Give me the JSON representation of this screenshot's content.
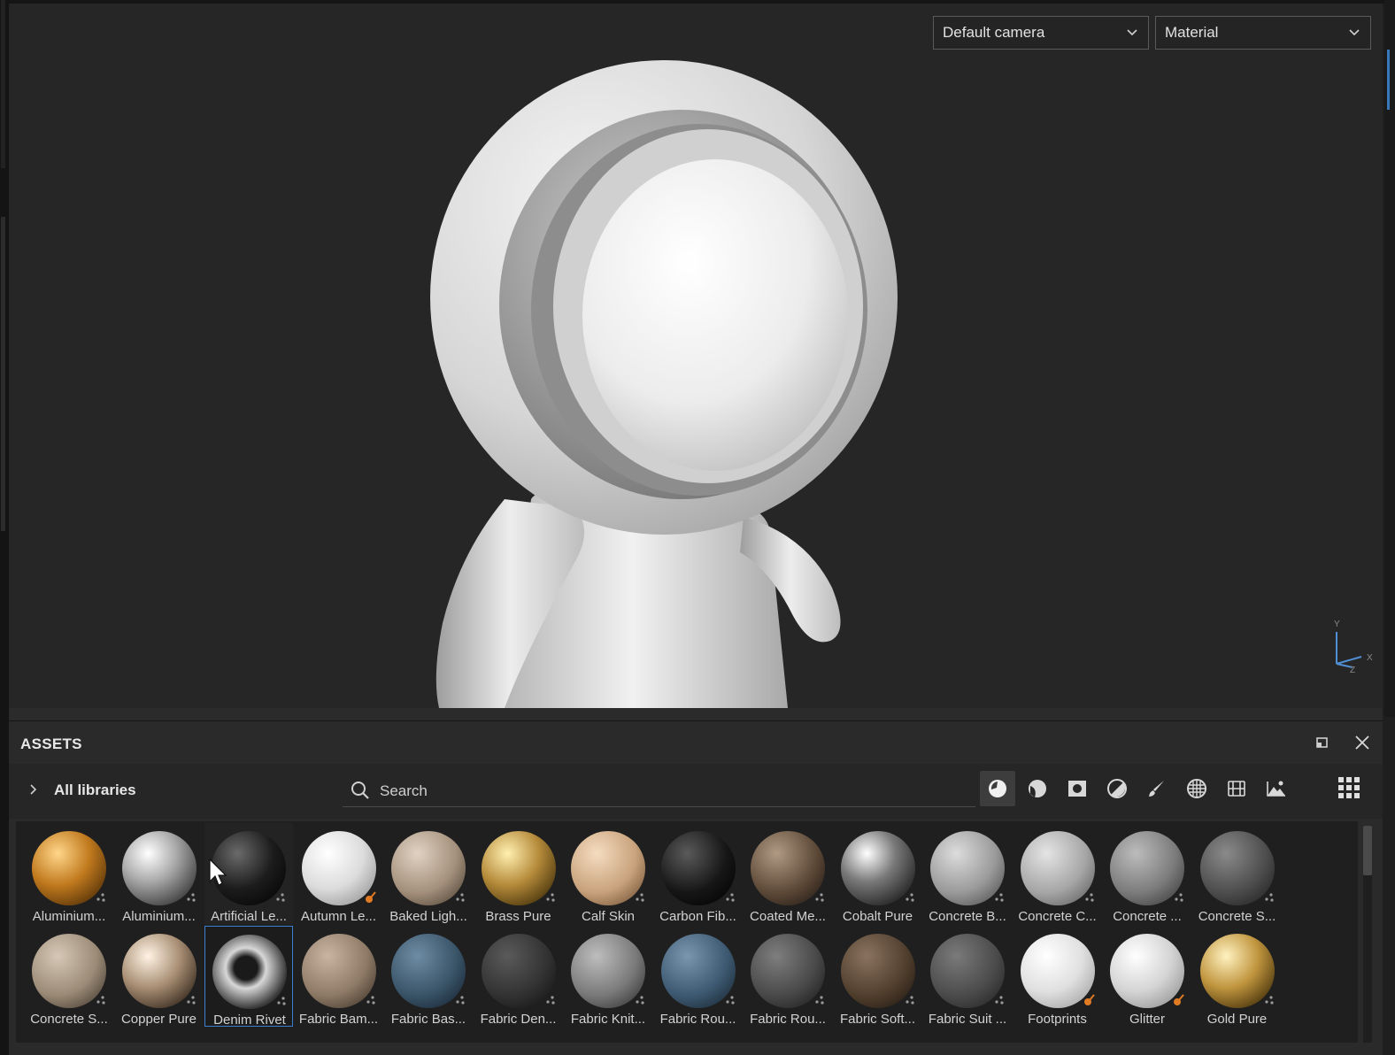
{
  "viewport": {
    "camera_select": "Default camera",
    "mode_select": "Material",
    "axis": {
      "y": "Y",
      "x": "X",
      "z": "Z"
    }
  },
  "assets_panel": {
    "title": "ASSETS",
    "libraries_label": "All libraries",
    "search_placeholder": "Search",
    "filters": [
      "materials-icon",
      "smart-materials-icon",
      "smart-masks-icon",
      "filters-icon",
      "brushes-icon",
      "textures-icon",
      "generators-icon",
      "environments-icon"
    ],
    "active_filter": "materials-icon"
  },
  "materials_row1": [
    {
      "label": "Aluminium...",
      "icon": "material-ball"
    },
    {
      "label": "Aluminium...",
      "icon": "material-ball"
    },
    {
      "label": "Artificial Le...",
      "icon": "material-ball"
    },
    {
      "label": "Autumn Le...",
      "icon": "material-ball"
    },
    {
      "label": "Baked Ligh...",
      "icon": "material-ball"
    },
    {
      "label": "Brass Pure",
      "icon": "material-ball"
    },
    {
      "label": "Calf Skin",
      "icon": "material-ball"
    },
    {
      "label": "Carbon Fib...",
      "icon": "material-ball"
    },
    {
      "label": "Coated Me...",
      "icon": "material-ball"
    },
    {
      "label": "Cobalt Pure",
      "icon": "material-ball"
    },
    {
      "label": "Concrete B...",
      "icon": "material-ball"
    },
    {
      "label": "Concrete C...",
      "icon": "material-ball"
    },
    {
      "label": "Concrete ...",
      "icon": "material-ball"
    },
    {
      "label": "Concrete S...",
      "icon": "material-ball"
    }
  ],
  "materials_row2": [
    {
      "label": "Concrete S...",
      "icon": "material-ball"
    },
    {
      "label": "Copper Pure",
      "icon": "material-ball"
    },
    {
      "label": "Denim Rivet",
      "icon": "material-ball"
    },
    {
      "label": "Fabric Bam...",
      "icon": "material-ball"
    },
    {
      "label": "Fabric Bas...",
      "icon": "material-ball"
    },
    {
      "label": "Fabric Den...",
      "icon": "material-ball"
    },
    {
      "label": "Fabric Knit...",
      "icon": "material-ball"
    },
    {
      "label": "Fabric Rou...",
      "icon": "material-ball"
    },
    {
      "label": "Fabric Rou...",
      "icon": "material-ball"
    },
    {
      "label": "Fabric Soft...",
      "icon": "material-ball"
    },
    {
      "label": "Fabric Suit ...",
      "icon": "material-ball"
    },
    {
      "label": "Footprints",
      "icon": "material-ball"
    },
    {
      "label": "Glitter",
      "icon": "material-ball"
    },
    {
      "label": "Gold Pure",
      "icon": "material-ball"
    }
  ],
  "selected_material": "Denim Rivet",
  "colors": {
    "accent": "#3a7fd0",
    "badge_orange": "#e07b24"
  }
}
